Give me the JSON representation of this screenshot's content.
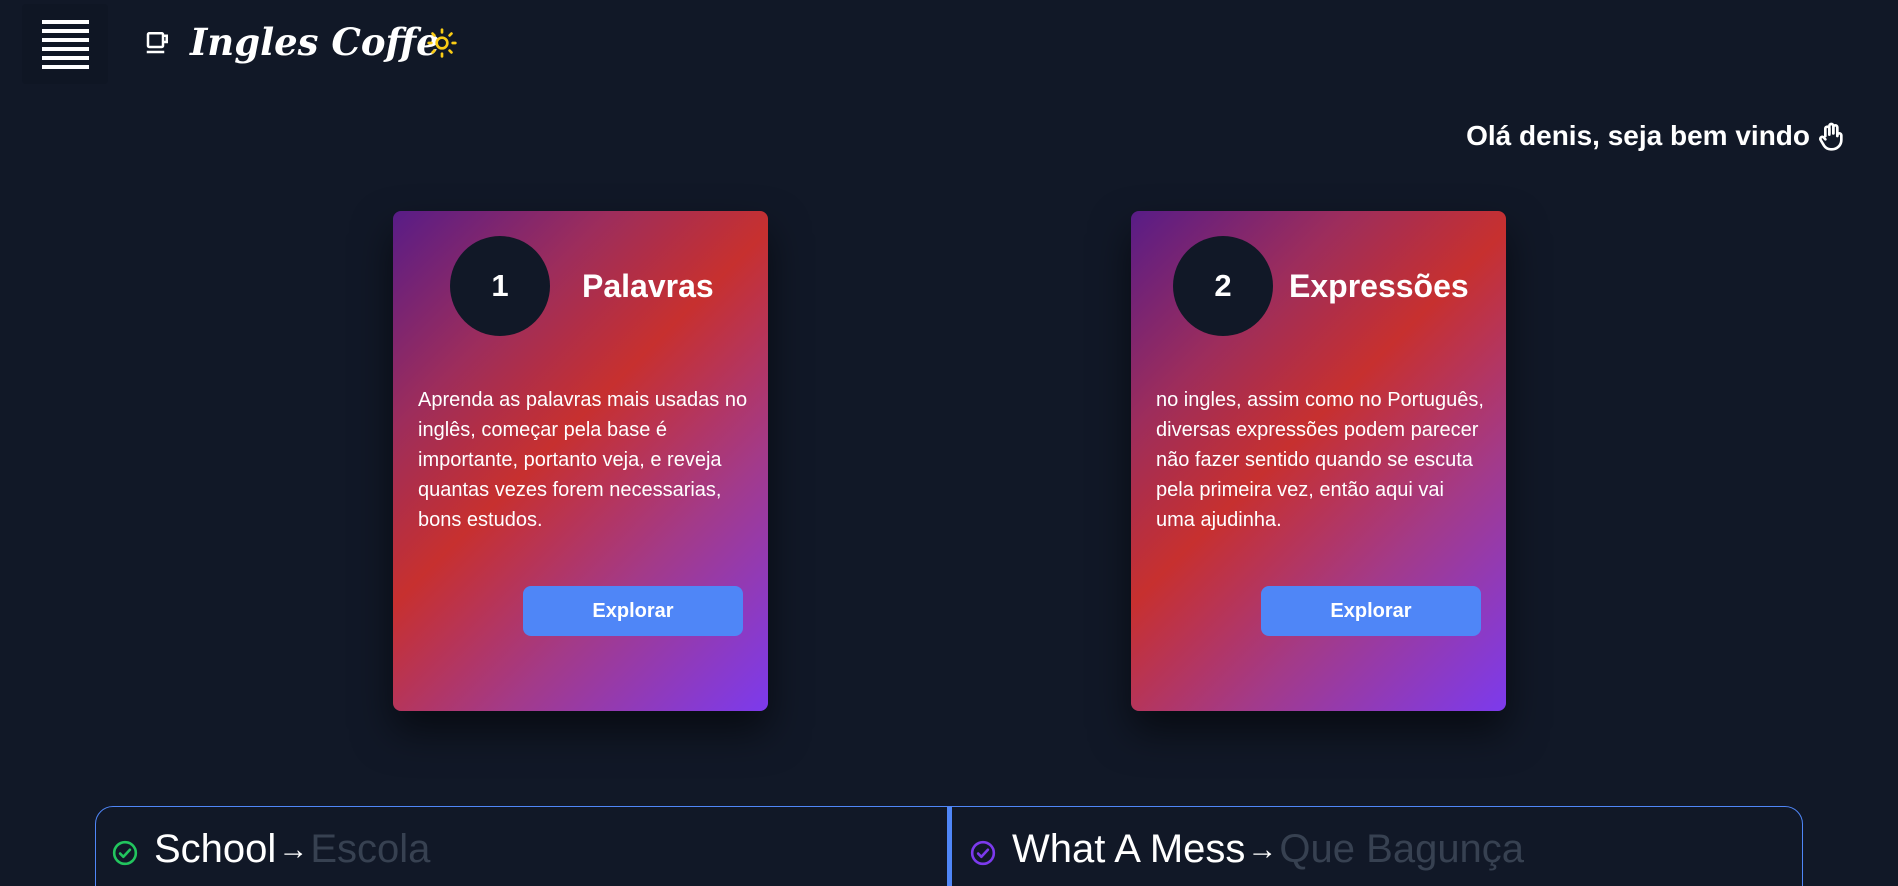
{
  "header": {
    "brand_title": "Ingles Coffe",
    "menu_icon": "hamburger-menu-icon",
    "brand_icon": "coffee-cup-icon",
    "theme_icon": "sun-icon",
    "theme_icon_color": "#facc15"
  },
  "greeting": {
    "text": "Olá denis, seja bem vindo",
    "icon": "waving-hand-icon"
  },
  "cards": [
    {
      "number": "1",
      "title": "Palavras",
      "description": "Aprenda as palavras mais usadas no inglês, começar pela base é importante, portanto veja, e reveja quantas vezes forem necessarias, bons estudos.",
      "button_label": "Explorar"
    },
    {
      "number": "2",
      "title": "Expressões",
      "description": "no ingles, assim como no Português, diversas expressões podem parecer não fazer sentido quando se escuta pela primeira vez, então aqui vai uma ajudinha.",
      "button_label": "Explorar"
    }
  ],
  "vocab": [
    {
      "english": "School",
      "arrow": "→",
      "portuguese": "Escola",
      "check_color": "#22c55e"
    },
    {
      "english": "What A Mess",
      "arrow": "→",
      "portuguese": "Que Bagunça",
      "check_color": "#7c3aed"
    }
  ],
  "colors": {
    "background": "#111827",
    "accent": "#4f86f7"
  }
}
